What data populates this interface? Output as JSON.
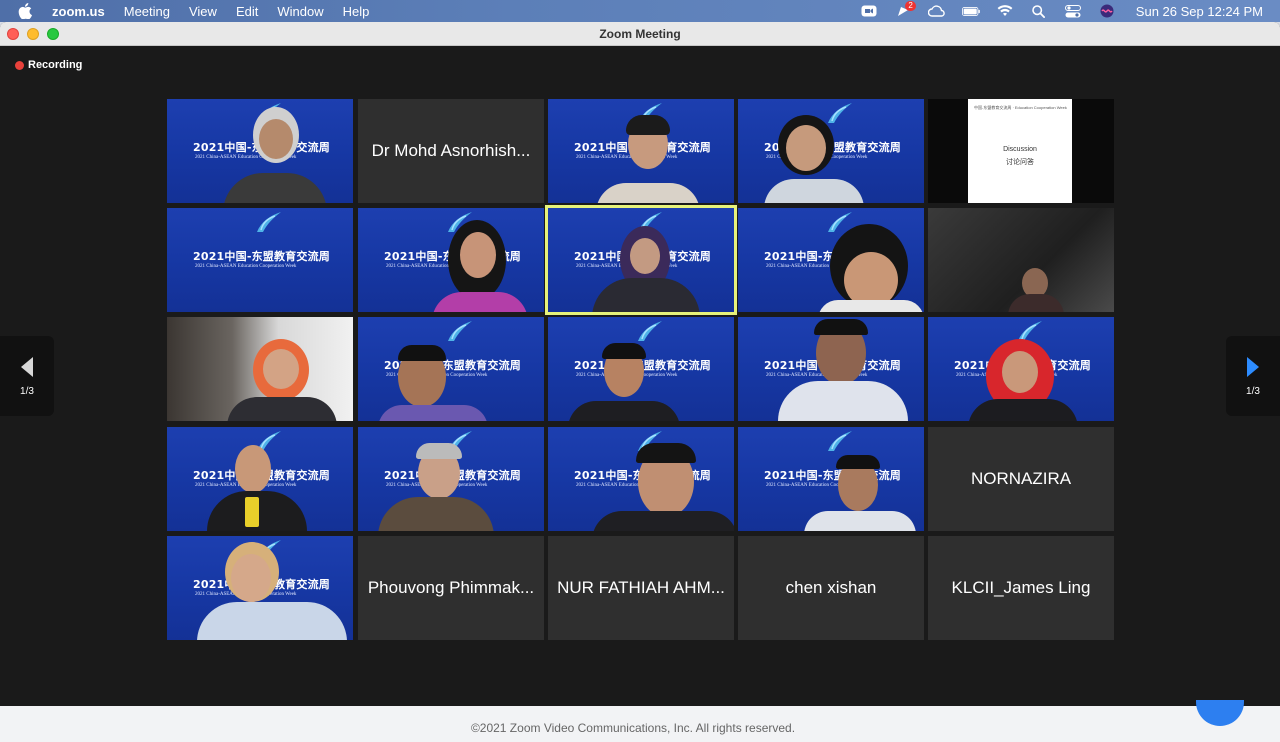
{
  "menubar": {
    "app": "zoom.us",
    "items": [
      "Meeting",
      "View",
      "Edit",
      "Window",
      "Help"
    ],
    "notification_count": "2",
    "clock": "Sun 26 Sep  12:24 PM"
  },
  "window": {
    "title": "Zoom Meeting"
  },
  "recording": {
    "label": "Recording",
    "color": "#e8413b"
  },
  "pager": {
    "left_label": "1/3",
    "right_label": "1/3"
  },
  "banner": {
    "title": "2021中国-东盟教育交流周",
    "subtitle": "2021 China-ASEAN Education Cooperation Week"
  },
  "slide": {
    "header": "中国-东盟教育交流周 · Education Cooperation Week",
    "title": "Discussion",
    "subtitle": "讨论问答"
  },
  "named_tiles": {
    "dr_mohd": "Dr Mohd Asnorhish...",
    "nornazira": "NORNAZIRA",
    "phouvong": "Phouvong Phimmak...",
    "nur_fathiah": "NUR FATHIAH AHM...",
    "chen_xishan": "chen xishan",
    "james_ling": "KLCII_James Ling"
  },
  "footer": {
    "copyright": "©2021 Zoom Video Communications, Inc. All rights reserved."
  },
  "colors": {
    "active_speaker": "#e7f27a",
    "accent": "#2d7ff0",
    "banner_blue": "#1d3fb0"
  }
}
